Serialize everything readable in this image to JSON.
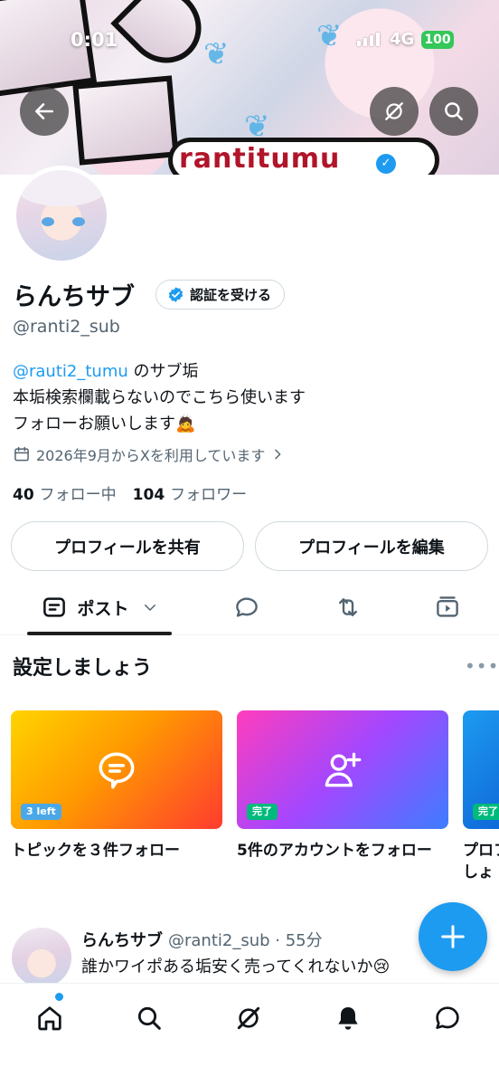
{
  "status_bar": {
    "time": "0:01",
    "network": "4G",
    "battery": "100"
  },
  "banner": {
    "logo_text": "rantitumu"
  },
  "profile": {
    "name": "らんちサブ",
    "verify_button": "認証を受ける",
    "handle": "@ranti2_sub",
    "bio": {
      "mention": "@rauti2_tumu",
      "line1_suffix": " のサブ垢",
      "line2": "本垢検索欄載らないのでこちら使います",
      "line3": "フォローお願いします🙇"
    },
    "joined": "2026年9月からXを利用しています",
    "following_count": "40",
    "following_label": "フォロー中",
    "followers_count": "104",
    "followers_label": "フォロワー",
    "share_button": "プロフィールを共有",
    "edit_button": "プロフィールを編集"
  },
  "tabs": {
    "posts_label": "ポスト"
  },
  "setup": {
    "title": "設定しましょう",
    "more": "•••",
    "cards": [
      {
        "label": "トピックを３件フォロー",
        "badge": "3 left",
        "icon": "chat-bubble-icon"
      },
      {
        "label": "5件のアカウントをフォロー",
        "badge": "完了",
        "icon": "add-user-icon"
      },
      {
        "label": "プロフ",
        "label2": "しょ",
        "badge": "完了"
      }
    ]
  },
  "post": {
    "author": "らんちサブ",
    "meta": "@ranti2_sub · 55分",
    "text": "誰かワイポある垢安く売ってくれないか😢"
  },
  "colors": {
    "accent": "#1d9bf0",
    "text": "#0f1419",
    "muted": "#536471",
    "border": "#cfd9de"
  }
}
